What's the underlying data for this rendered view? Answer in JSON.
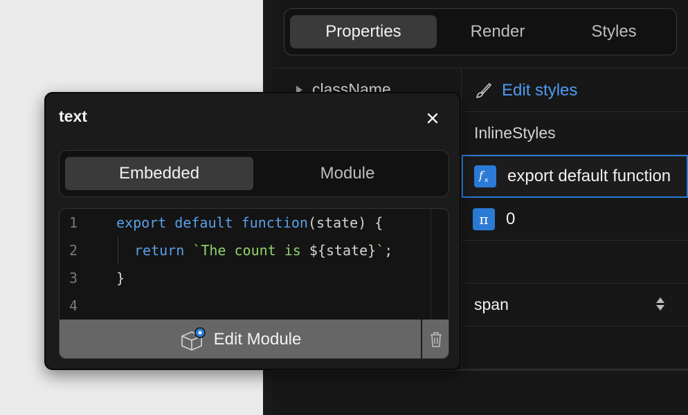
{
  "panel": {
    "tabs": [
      {
        "label": "Properties",
        "active": true
      },
      {
        "label": "Render",
        "active": false
      },
      {
        "label": "Styles",
        "active": false
      }
    ],
    "prop_name": "className",
    "edit_styles": "Edit styles",
    "inline_styles": "InlineStyles",
    "function_badge": "fx",
    "function_value": "export default function",
    "pi_badge": "π",
    "pi_value": "0",
    "tag_select": "span"
  },
  "popup": {
    "title": "text",
    "segments": [
      {
        "label": "Embedded",
        "active": true
      },
      {
        "label": "Module",
        "active": false
      }
    ],
    "code_lines": [
      {
        "num": "1"
      },
      {
        "num": "2"
      },
      {
        "num": "3"
      },
      {
        "num": "4"
      }
    ],
    "code": {
      "l1_kw": "export default function",
      "l1_rest": "(state) {",
      "l2_kw": "return",
      "l2_str_open": "`The count is ",
      "l2_interp": "${state}",
      "l2_str_close": "`",
      "l2_end": ";",
      "l3": "}"
    },
    "edit_module": "Edit Module"
  },
  "colors": {
    "accent": "#2b7bd6",
    "link": "#4d9bf2",
    "keyword": "#5aa0e8",
    "string": "#8fd36b"
  }
}
